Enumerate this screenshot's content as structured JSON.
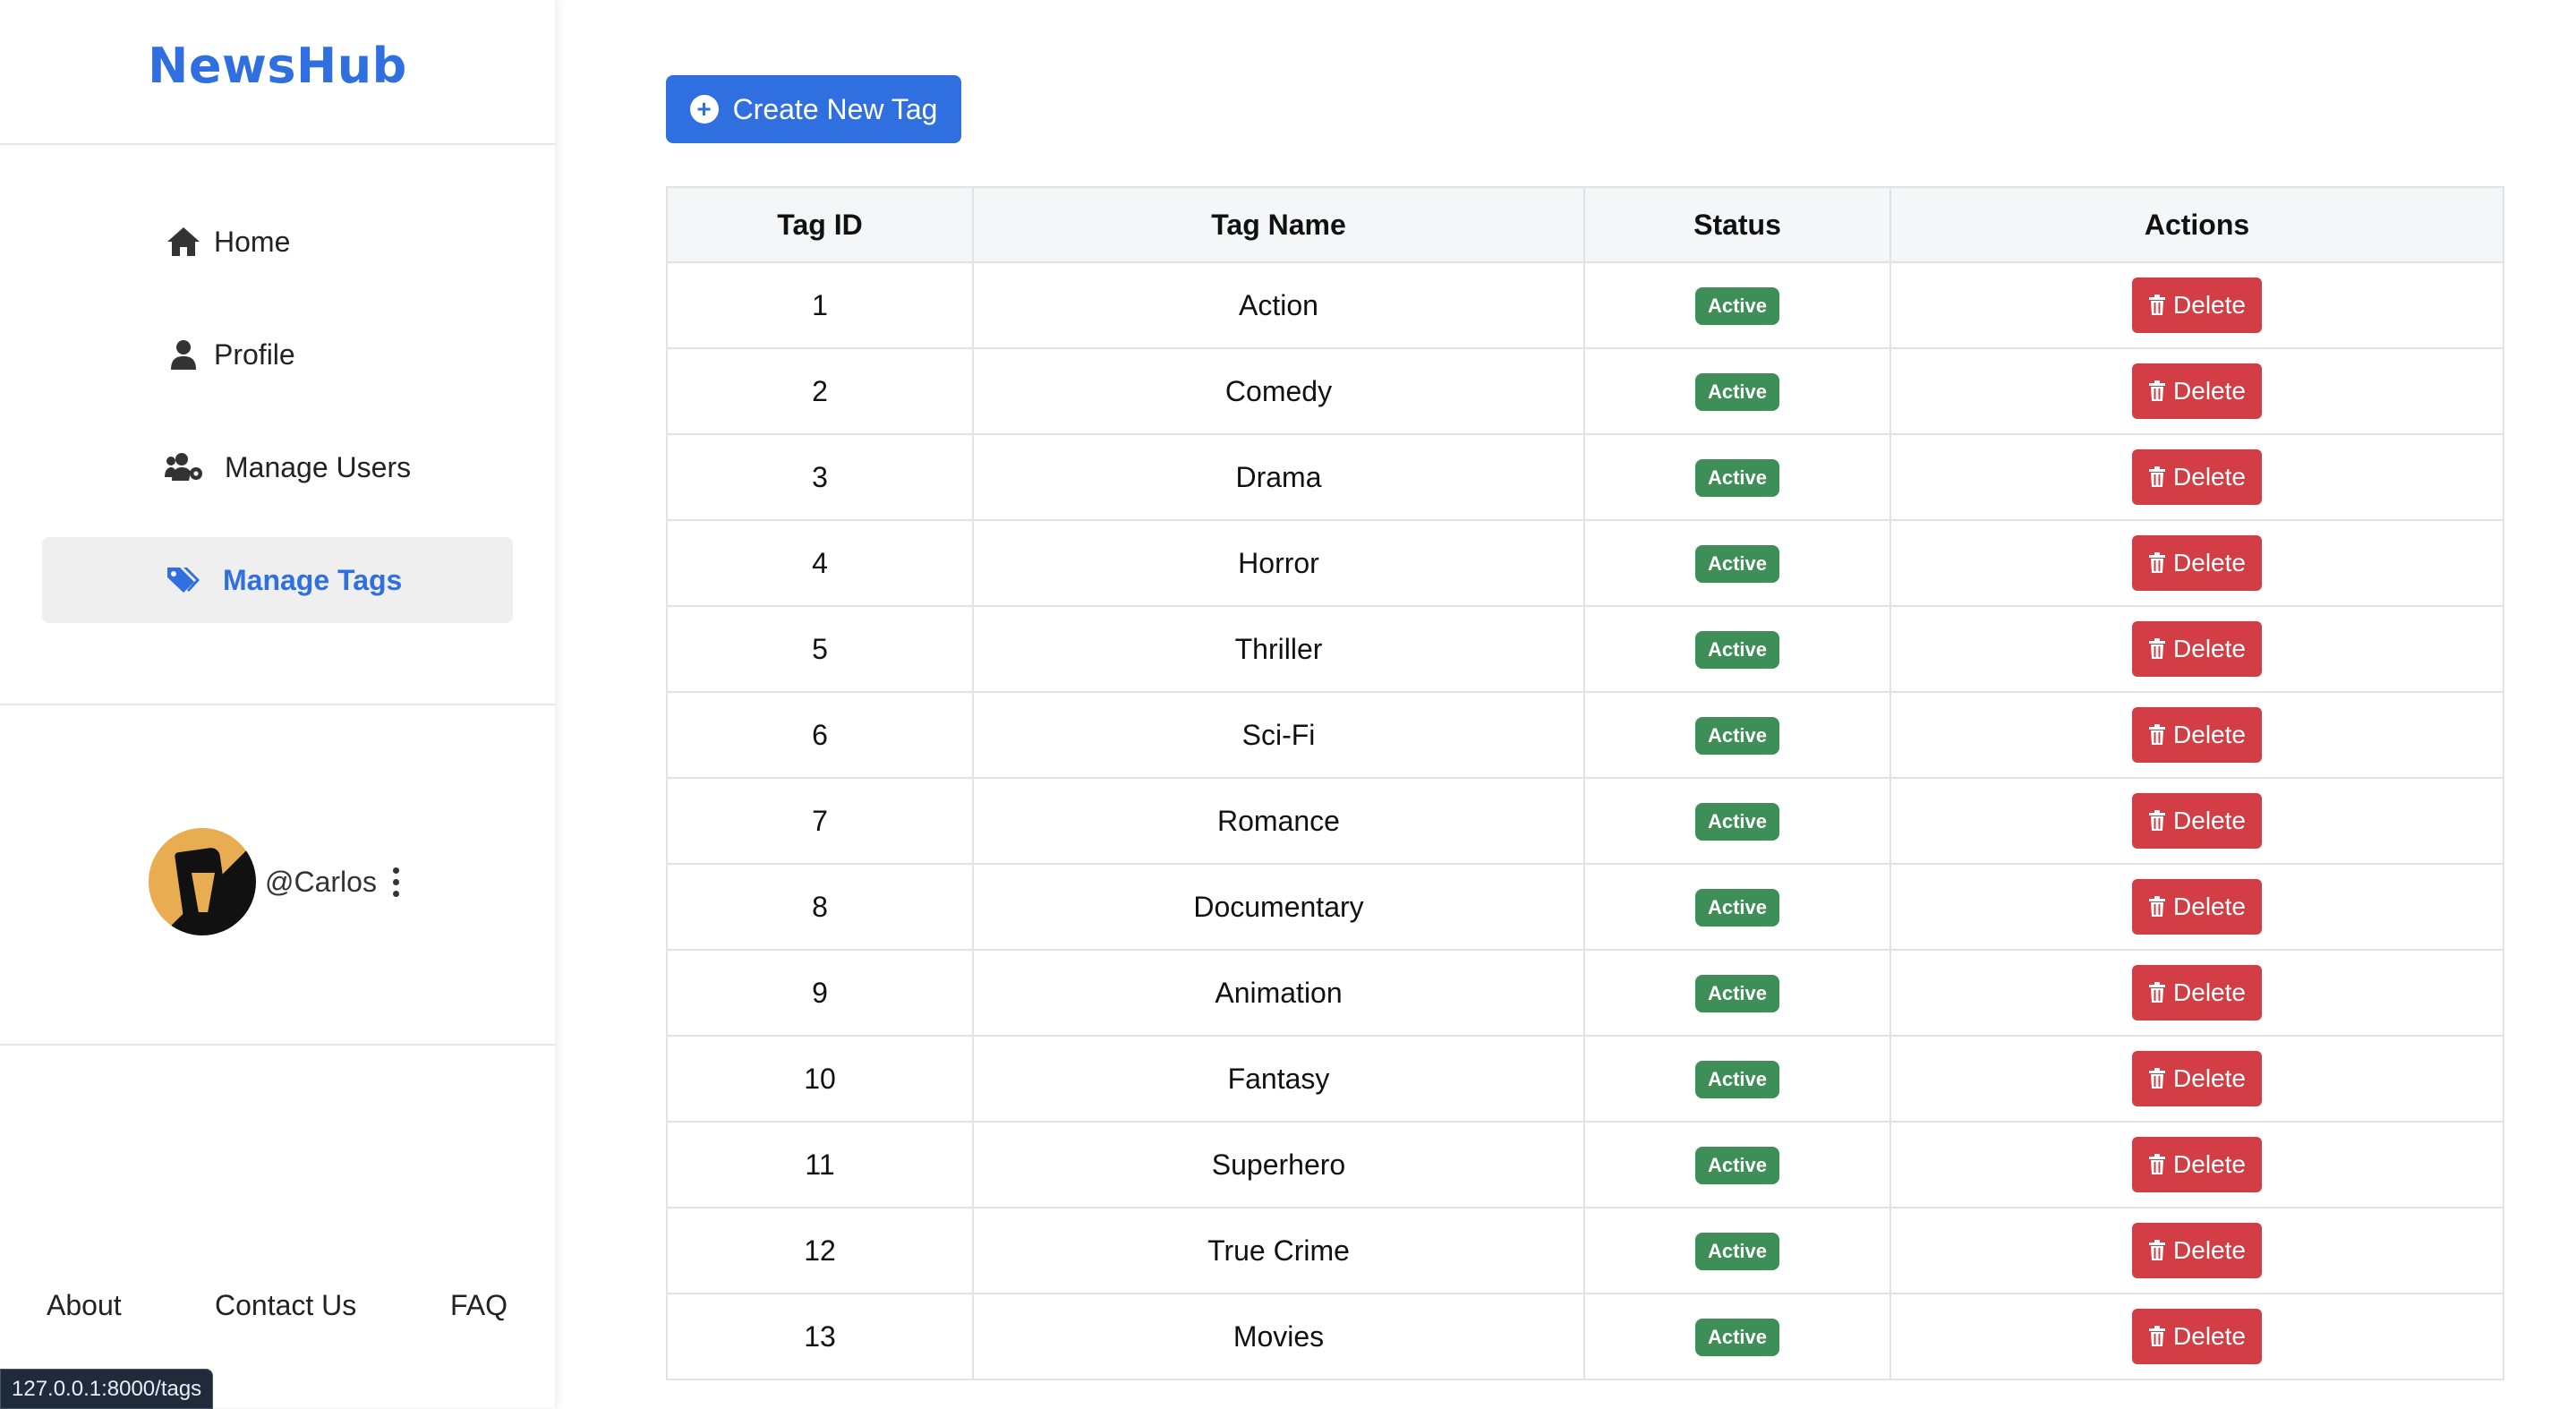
{
  "brand": "NewsHub",
  "nav": [
    {
      "label": "Home",
      "icon": "home-icon",
      "active": false
    },
    {
      "label": "Profile",
      "icon": "user-icon",
      "active": false
    },
    {
      "label": "Manage Users",
      "icon": "users-cog-icon",
      "active": false
    },
    {
      "label": "Manage Tags",
      "icon": "tags-icon",
      "active": true
    }
  ],
  "profile": {
    "handle": "@Carlos"
  },
  "footer": {
    "about": "About",
    "contact": "Contact Us",
    "faq": "FAQ"
  },
  "statusbar": {
    "url": "127.0.0.1:8000/tags"
  },
  "create_button": {
    "label": "Create New Tag"
  },
  "table": {
    "headers": {
      "id": "Tag ID",
      "name": "Tag Name",
      "status": "Status",
      "actions": "Actions"
    },
    "delete_label": "Delete",
    "rows": [
      {
        "id": "1",
        "name": "Action",
        "status": "Active"
      },
      {
        "id": "2",
        "name": "Comedy",
        "status": "Active"
      },
      {
        "id": "3",
        "name": "Drama",
        "status": "Active"
      },
      {
        "id": "4",
        "name": "Horror",
        "status": "Active"
      },
      {
        "id": "5",
        "name": "Thriller",
        "status": "Active"
      },
      {
        "id": "6",
        "name": "Sci-Fi",
        "status": "Active"
      },
      {
        "id": "7",
        "name": "Romance",
        "status": "Active"
      },
      {
        "id": "8",
        "name": "Documentary",
        "status": "Active"
      },
      {
        "id": "9",
        "name": "Animation",
        "status": "Active"
      },
      {
        "id": "10",
        "name": "Fantasy",
        "status": "Active"
      },
      {
        "id": "11",
        "name": "Superhero",
        "status": "Active"
      },
      {
        "id": "12",
        "name": "True Crime",
        "status": "Active"
      },
      {
        "id": "13",
        "name": "Movies",
        "status": "Active"
      }
    ]
  },
  "colors": {
    "accent": "#2f6fe0",
    "badge": "#3e8e58",
    "danger": "#d33d45"
  }
}
